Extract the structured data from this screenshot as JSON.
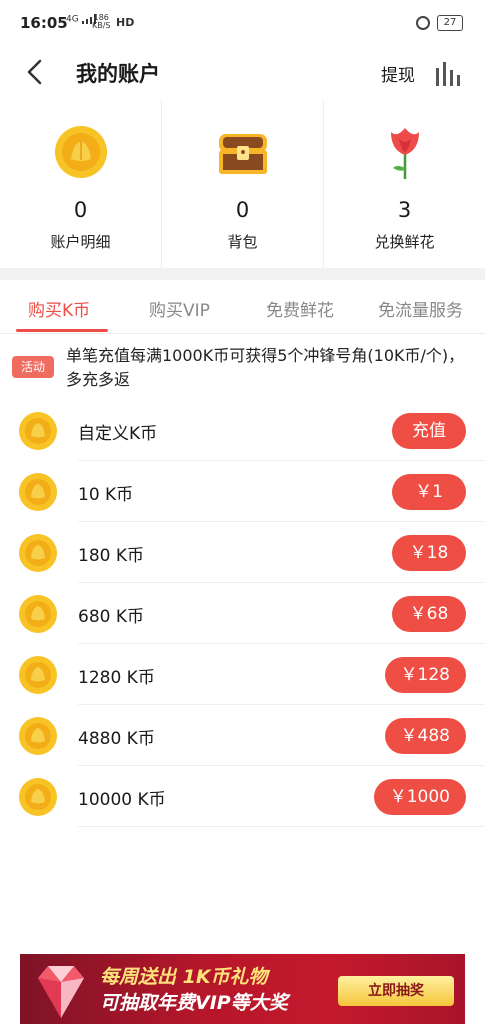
{
  "status_bar": {
    "time": "16:05",
    "network": "4G",
    "speed_top": "186",
    "speed_bottom": "KB/S",
    "hd": "HD",
    "battery": "27"
  },
  "header": {
    "title": "我的账户",
    "withdraw_label": "提现"
  },
  "summary": [
    {
      "icon": "coin-icon",
      "value": "0",
      "label": "账户明细"
    },
    {
      "icon": "treasure-chest-icon",
      "value": "0",
      "label": "背包"
    },
    {
      "icon": "rose-icon",
      "value": "3",
      "label": "兑换鲜花"
    }
  ],
  "tabs": [
    {
      "label": "购买K币",
      "active": true
    },
    {
      "label": "购买VIP",
      "active": false
    },
    {
      "label": "免费鲜花",
      "active": false
    },
    {
      "label": "免流量服务",
      "active": false
    }
  ],
  "promo": {
    "badge": "活动",
    "text": "单笔充值每满1000K币可获得5个冲锋号角(10K币/个)，多充多返"
  },
  "packages": [
    {
      "name": "自定义K币",
      "price": "充值"
    },
    {
      "name": "10 K币",
      "price": "￥1"
    },
    {
      "name": "180 K币",
      "price": "￥18"
    },
    {
      "name": "680 K币",
      "price": "￥68"
    },
    {
      "name": "1280 K币",
      "price": "￥128"
    },
    {
      "name": "4880 K币",
      "price": "￥488"
    },
    {
      "name": "10000 K币",
      "price": "￥1000"
    }
  ],
  "banner": {
    "line1": "每周送出 1K币礼物",
    "line2": "可抽取年费VIP等大奖",
    "cta": "立即抽奖"
  },
  "colors": {
    "accent": "#ee4e45",
    "coin": "#f7c325",
    "coin_inner": "#f2ad17"
  }
}
